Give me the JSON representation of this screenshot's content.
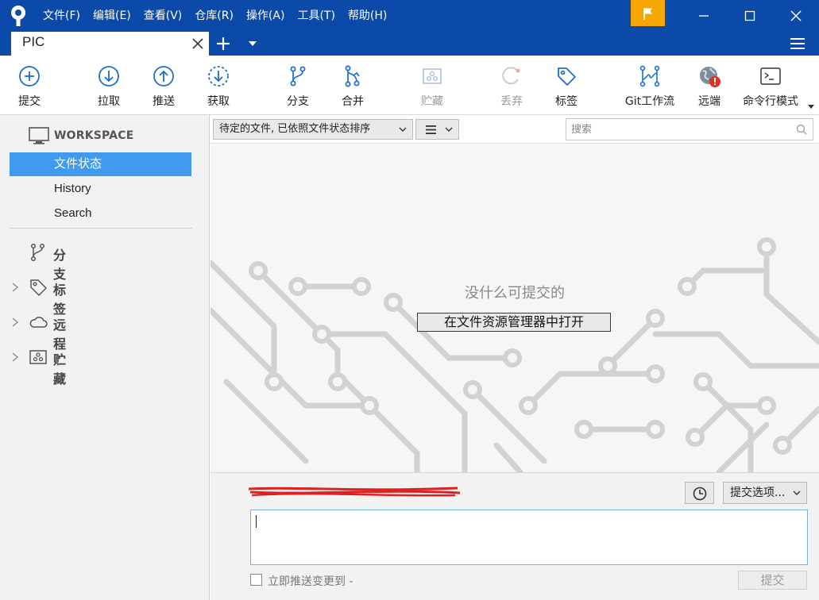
{
  "menu": {
    "items": [
      "文件(F)",
      "编辑(E)",
      "查看(V)",
      "仓库(R)",
      "操作(A)",
      "工具(T)",
      "帮助(H)"
    ]
  },
  "tabs": {
    "active_label": "PIC"
  },
  "toolbar": {
    "commit": "提交",
    "pull": "拉取",
    "push": "推送",
    "fetch": "获取",
    "branch": "分支",
    "merge": "合并",
    "stash": "贮藏",
    "discard": "丢弃",
    "tag": "标签",
    "gitflow": "Git工作流",
    "remote": "远端",
    "terminal": "命令行模式"
  },
  "sidebar": {
    "workspace": "WORKSPACE",
    "items": [
      "文件状态",
      "History",
      "Search"
    ],
    "active_index": 0,
    "groups": {
      "branches": "分支",
      "tags": "标签",
      "remotes": "远程",
      "stashes": "贮藏"
    }
  },
  "filter": {
    "sort_label": "待定的文件, 已依照文件状态排序",
    "search_placeholder": "搜索"
  },
  "main": {
    "empty_message": "没什么可提交的",
    "open_explorer": "在文件资源管理器中打开"
  },
  "commit": {
    "options_label": "提交选项...",
    "push_immediately": "立即推送变更到 -",
    "commit_button": "提交"
  },
  "colors": {
    "titlebar": "#0b4aa8",
    "accent": "#3f9af0",
    "icon_blue": "#1a6fd0",
    "flag": "#f6a600",
    "alert": "#e0301e"
  }
}
